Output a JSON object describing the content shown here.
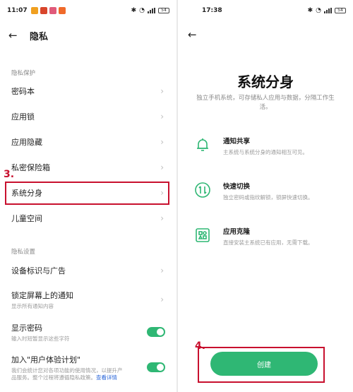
{
  "left_screen": {
    "status": {
      "time": "11:07",
      "battery": "54"
    },
    "header": {
      "back_icon": "back-arrow-icon",
      "title": "隐私"
    },
    "section_privacy_protection": "隐私保护",
    "items": [
      {
        "label": "密码本"
      },
      {
        "label": "应用锁"
      },
      {
        "label": "应用隐藏"
      },
      {
        "label": "私密保险箱"
      },
      {
        "label": "系统分身"
      },
      {
        "label": "儿童空间"
      }
    ],
    "section_privacy_settings": "隐私设置",
    "settings": {
      "device_id_ads": "设备标识与广告",
      "lockscreen_notifications": "锁定屏幕上的通知",
      "lockscreen_notifications_sub": "显示所有通知内容",
      "show_password": "显示密码",
      "show_password_sub": "输入时短暂显示这些字符",
      "user_experience": "加入\"用户体验计划\"",
      "user_experience_sub_1": "我们会统计您对各项功能的使用情况，以提升产",
      "user_experience_sub_2": "品服务。整个过程将遵循隐私政策。",
      "user_experience_link": "查看详情"
    },
    "annotation_step": "3."
  },
  "right_screen": {
    "status": {
      "time": "17:38",
      "battery": "54"
    },
    "title": "系统分身",
    "description": "独立手机系统，可存储私人应用与数据，分隔工作生活。",
    "features": [
      {
        "title": "通知共享",
        "desc": "主系统与系统分身的通知相互可见。",
        "icon": "bell-icon"
      },
      {
        "title": "快速切换",
        "desc": "独立密码或指纹解锁，锁屏快速切换。",
        "icon": "switch-icon"
      },
      {
        "title": "应用克隆",
        "desc": "直接安装主系统已有应用，无需下载。",
        "icon": "app-clone-icon"
      }
    ],
    "create_label": "创建",
    "annotation_step": "4."
  },
  "colors": {
    "accent_green": "#2fb774",
    "annotation_red": "#c8102e",
    "link_blue": "#2a66d8"
  }
}
